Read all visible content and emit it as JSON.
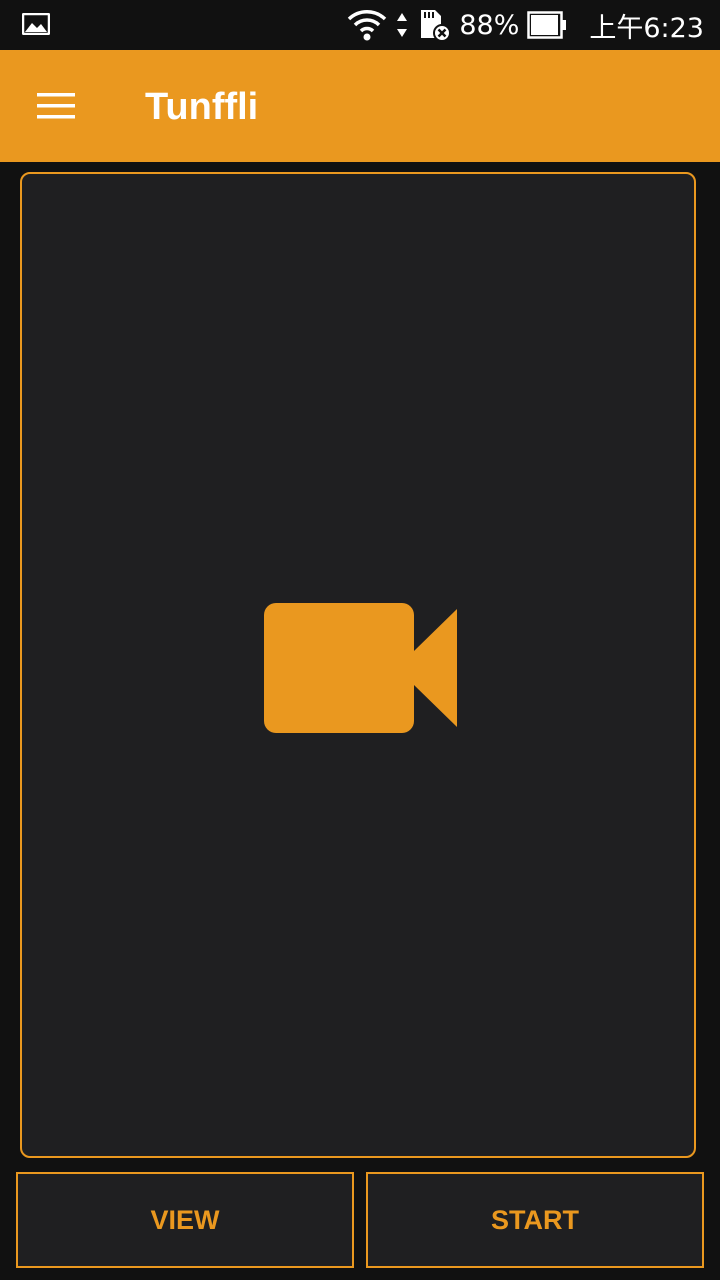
{
  "status_bar": {
    "battery_percent": "88%",
    "time": "上午6:23",
    "icons": [
      "image-notification-icon",
      "wifi-icon",
      "data-arrows-icon",
      "sd-card-error-icon",
      "battery-icon"
    ]
  },
  "app_bar": {
    "title": "Tunffli",
    "menu_icon": "hamburger-menu-icon"
  },
  "preview": {
    "icon": "video-camera-icon"
  },
  "buttons": {
    "view_label": "VIEW",
    "start_label": "START"
  },
  "colors": {
    "accent": "#EA981F",
    "background": "#111111",
    "panel": "#1F1F21",
    "status_text": "#FFFFFF"
  }
}
